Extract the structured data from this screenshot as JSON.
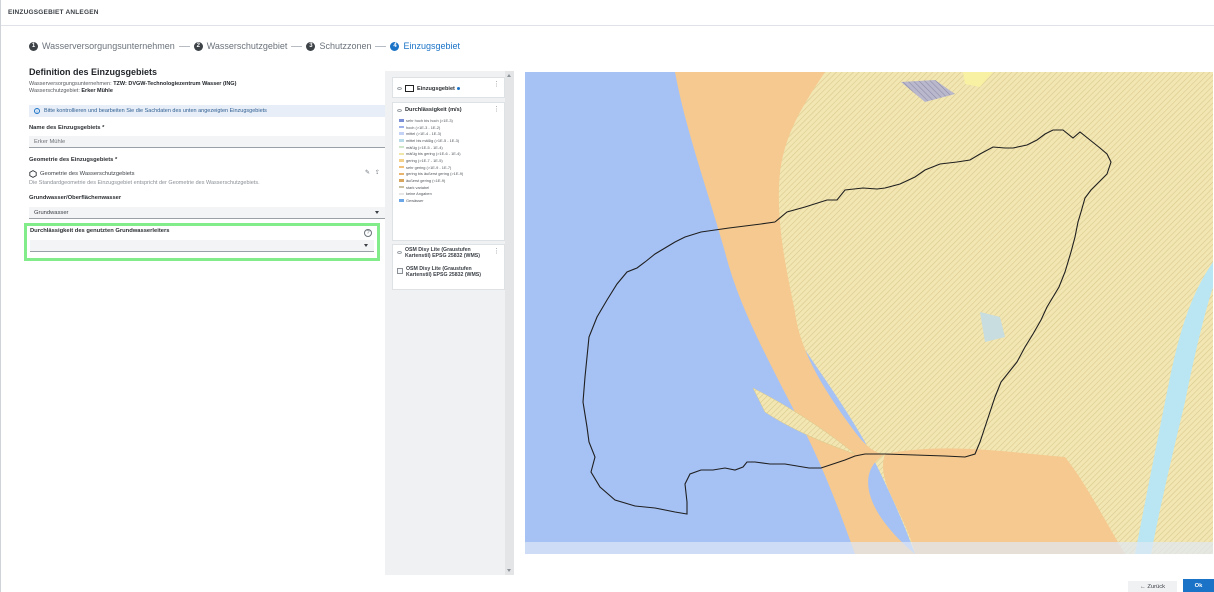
{
  "header": {
    "title": "EINZUGSGEBIET ANLEGEN"
  },
  "stepper": {
    "steps": [
      {
        "number": "1",
        "label": "Wasserversorgungsunternehmen"
      },
      {
        "number": "2",
        "label": "Wasserschutzgebiet"
      },
      {
        "number": "3",
        "label": "Schutzzonen"
      },
      {
        "number": "4",
        "label": "Einzugsgebiet"
      }
    ],
    "active_index": 3
  },
  "form": {
    "title": "Definition des Einzugsgebiets",
    "wvu_prefix": "Wasserversorgungsunternehmen:",
    "wvu_value": "TZW: DVGW-Technologiezentrum Wasser (ING)",
    "wsg_prefix": "Wasserschutzgebiet:",
    "wsg_value": "Erker Mühle",
    "info": "Bitte kontrollieren und bearbeiten Sie die Sachdaten des unten angezeigten Einzugsgebiets",
    "name_label": "Name des Einzugsgebiets *",
    "name_value": "Erker Mühle",
    "geometry_label": "Geometrie des Einzugsgebiets *",
    "geometry_name": "Geometrie des Wasserschutzgebiets",
    "geometry_hint": "Die Standardgeometrie des Einzugsgebiet entspricht der Geometrie des Wasserschutzgebiets.",
    "water_label": "Grundwasser/Oberflächenwasser",
    "water_value": "Grundwasser",
    "perm_label": "Durchlässigkeit des genutzten Grundwasserleiters",
    "perm_value": ""
  },
  "layers": {
    "einzugsgebiet_title": "Einzugsgebiet",
    "durchlaessigkeit_title": "Durchlässigkeit (m/s)",
    "legend": [
      {
        "label": "sehr hoch bis hoch (>1E-3)",
        "color": "#7a8fd6"
      },
      {
        "label": "hoch (>1E-3 - 1E-2)",
        "color": "#9fb1ea"
      },
      {
        "label": "mittel (>1E-4 - 1E-3)",
        "color": "#c4d2f5"
      },
      {
        "label": "mittel bis mäßig (>1E-5 - 1E-3)",
        "color": "#b9dceb"
      },
      {
        "label": "mäßig (>1E-5 - 1E-4)",
        "color": "#cfe7c9"
      },
      {
        "label": "mäßig bis gering (>1E-6 - 1E-4)",
        "color": "#f0e6a8"
      },
      {
        "label": "gering (>1E-7 - 1E-5)",
        "color": "#f5d28c"
      },
      {
        "label": "sehr gering (>1E-9 - 1E-7)",
        "color": "#f2c27a"
      },
      {
        "label": "gering bis äußerst gering (>1E-9)",
        "color": "#e8b46b"
      },
      {
        "label": "äußerst gering (<1E-9)",
        "color": "#d9a65e"
      },
      {
        "label": "stark variabel",
        "color": "#c9c0a0"
      },
      {
        "label": "keine Angaben",
        "color": "#e6e6e6"
      },
      {
        "label": "Gewässer",
        "color": "#6aa6e8"
      }
    ],
    "osm_layer_label": "OSM Disy Lite (Graustufen Kartenstil) EPSG 25832 (WMS)",
    "osm_check_label": "OSM Disy Lite (Graustufen Kartenstil) EPSG 25832 (WMS)"
  },
  "footer": {
    "back_label": "← Zurück",
    "ok_label": "Ok"
  }
}
